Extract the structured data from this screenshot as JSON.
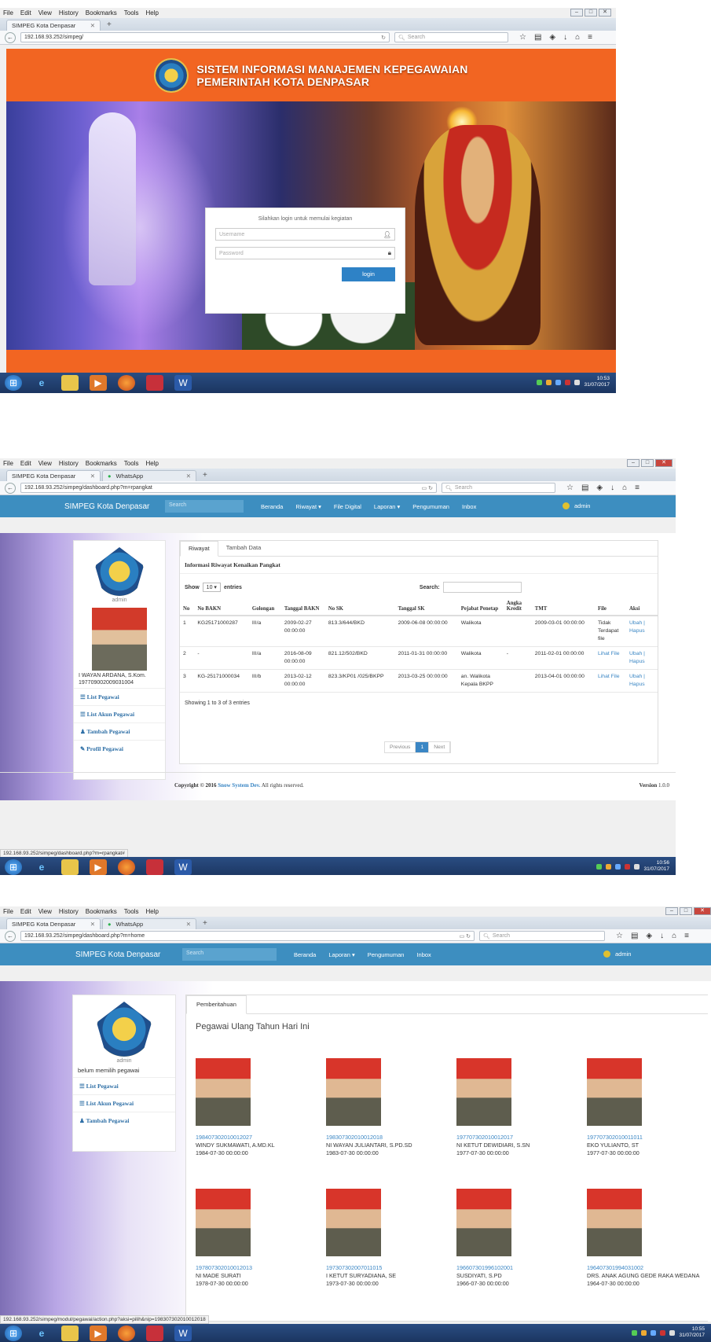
{
  "browser": {
    "menu": [
      "File",
      "Edit",
      "View",
      "History",
      "Bookmarks",
      "Tools",
      "Help"
    ],
    "search_placeholder": "Search",
    "tab_title": "SIMPEG Kota Denpasar",
    "tab_whatsapp": "WhatsApp"
  },
  "screen1": {
    "url": "192.168.93.252/simpeg/",
    "title_line1": "SISTEM INFORMASI MANAJEMEN KEPEGAWAIAN",
    "title_line2": "PEMERINTAH KOTA DENPASAR",
    "login_hint": "Silahkan login untuk memulai kegiatan",
    "username_placeholder": "Username",
    "password_placeholder": "Password",
    "login_button": "login",
    "clock_time": "10:53",
    "clock_date": "31/07/2017"
  },
  "screen2": {
    "url": "192.168.93.252/simpeg/dashboard.php?m=rpangkat",
    "brand": "SIMPEG Kota Denpasar",
    "nav_search": "Search",
    "nav": [
      "Beranda",
      "Riwayat ▾",
      "File Digital",
      "Laporan ▾",
      "Pengumuman",
      "Inbox"
    ],
    "user": "admin",
    "sidebar_admin": "admin",
    "employee_name": "I WAYAN ARDANA, S.Kom.",
    "employee_nip": "197709002009031004",
    "sidebar_items": [
      "List Pegawai",
      "List Akun Pegawai",
      "Tambah Pegawai",
      "Profil Pegawai"
    ],
    "tabs": [
      "Riwayat",
      "Tambah Data"
    ],
    "panel_title": "Informasi Riwayat Kenaikan Pangkat",
    "show_label": "Show",
    "entries_value": "10",
    "entries_label": "entries",
    "search_label": "Search:",
    "columns": [
      "No",
      "No BAKN",
      "Golongan",
      "Tanggal BAKN",
      "No SK",
      "Tanggal SK",
      "Pejabat Penetap",
      "Angka Kredit",
      "TMT",
      "File",
      "Aksi"
    ],
    "rows": [
      [
        "1",
        "KG25171000287",
        "III/a",
        "2009-02-27 00:00:00",
        "813.3/644/BKD",
        "2009-06-08 00:00:00",
        "Walikota",
        "",
        "2009-03-01 00:00:00",
        "Tidak Terdapat file",
        "Ubah | Hapus"
      ],
      [
        "2",
        "-",
        "III/a",
        "2016-08-09 00:00:00",
        "821.12/502/BKD",
        "2011-01-31 00:00:00",
        "Walikota",
        "-",
        "2011-02-01 00:00:00",
        "Lihat File",
        "Ubah | Hapus"
      ],
      [
        "3",
        "KG-25171000034",
        "III/b",
        "2013-02-12 00:00:00",
        "823.3/KP01 /025/BKPP",
        "2013-03-25 00:00:00",
        "an. Walikota Kepala BKPP",
        "",
        "2013-04-01 00:00:00",
        "Lihat File",
        "Ubah | Hapus"
      ]
    ],
    "showing": "Showing 1 to 3 of 3 entries",
    "prev": "Previous",
    "page": "1",
    "next": "Next",
    "copyright_pre": "Copyright © 2016",
    "copyright_link": "Snow System Dev.",
    "copyright_post": "All rights reserved.",
    "version_label": "Version",
    "version": "1.0.0",
    "status_url": "192.168.93.252/simpeg/dashboard.php?m=rpangkat#",
    "clock_time": "10:56",
    "clock_date": "31/07/2017"
  },
  "screen3": {
    "url": "192.168.93.252/simpeg/dashboard.php?m=home",
    "brand": "SIMPEG Kota Denpasar",
    "nav_search": "Search",
    "nav": [
      "Beranda",
      "Laporan ▾",
      "Pengumuman",
      "Inbox"
    ],
    "user": "admin",
    "sidebar_admin": "admin",
    "sidebar_note": "belum memilih pegawai",
    "sidebar_items": [
      "List Pegawai",
      "List Akun Pegawai",
      "Tambah Pegawai"
    ],
    "tab": "Pemberitahuan",
    "heading": "Pegawai Ulang Tahun Hari Ini",
    "people": [
      {
        "nip": "198407302010012027",
        "name": "WINDY SUKMAWATI, A.MD.KL",
        "date": "1984-07-30 00:00:00"
      },
      {
        "nip": "198307302010012018",
        "name": "NI WAYAN JULIANTARI, S.PD.SD",
        "date": "1983-07-30 00:00:00"
      },
      {
        "nip": "197707302010012017",
        "name": "NI KETUT DEWIDIARI, S.SN",
        "date": "1977-07-30 00:00:00"
      },
      {
        "nip": "197707302010011011",
        "name": "EKO YULIANTO, ST",
        "date": "1977-07-30 00:00:00"
      },
      {
        "nip": "197807302010012013",
        "name": "NI MADE SURATI",
        "date": "1978-07-30 00:00:00"
      },
      {
        "nip": "197307302007011015",
        "name": "I KETUT SURYADIANA, SE",
        "date": "1973-07-30 00:00:00"
      },
      {
        "nip": "196607301996102001",
        "name": "SUSDIYATI, S.PD",
        "date": "1966-07-30 00:00:00"
      },
      {
        "nip": "196407301994031002",
        "name": "DRS. ANAK AGUNG GEDE RAKA WEDANA",
        "date": "1964-07-30 00:00:00"
      }
    ],
    "status_url": "192.168.93.252/simpeg/modul/pegawai/action.php?aksi=pilih&nip=198307302010012018",
    "clock_time": "10:55",
    "clock_date": "31/07/2017"
  }
}
